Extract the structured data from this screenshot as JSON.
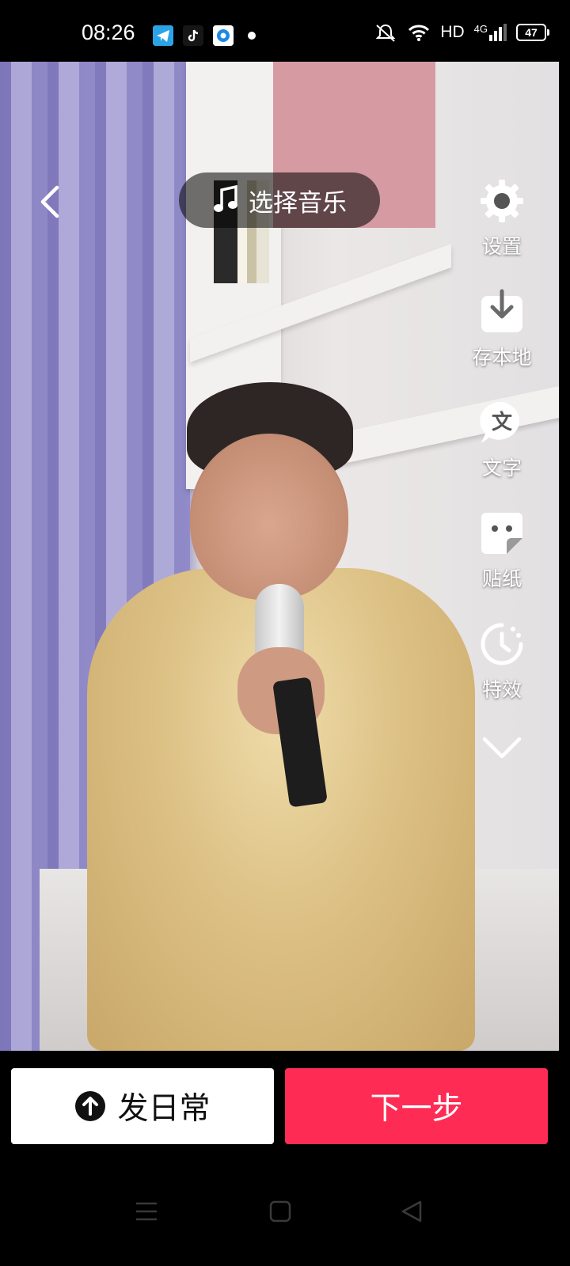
{
  "status_bar": {
    "time": "08:26",
    "network": "HD",
    "cellular": "4G",
    "battery": "47",
    "app_icons": [
      "telegram-icon",
      "tiktok-icon",
      "browser-icon"
    ]
  },
  "top": {
    "back_icon": "chevron-left-icon",
    "music_label": "选择音乐",
    "music_icon": "music-note-icon"
  },
  "side_menu": [
    {
      "label": "设置",
      "icon": "gear-icon"
    },
    {
      "label": "存本地",
      "icon": "download-icon"
    },
    {
      "label": "文字",
      "icon": "text-icon"
    },
    {
      "label": "贴纸",
      "icon": "sticker-icon"
    },
    {
      "label": "特效",
      "icon": "effects-timer-icon"
    }
  ],
  "bottom": {
    "daily_label": "发日常",
    "daily_icon": "upload-arrow-icon",
    "next_label": "下一步"
  },
  "colors": {
    "accent": "#fe2c55",
    "background": "#000000"
  }
}
